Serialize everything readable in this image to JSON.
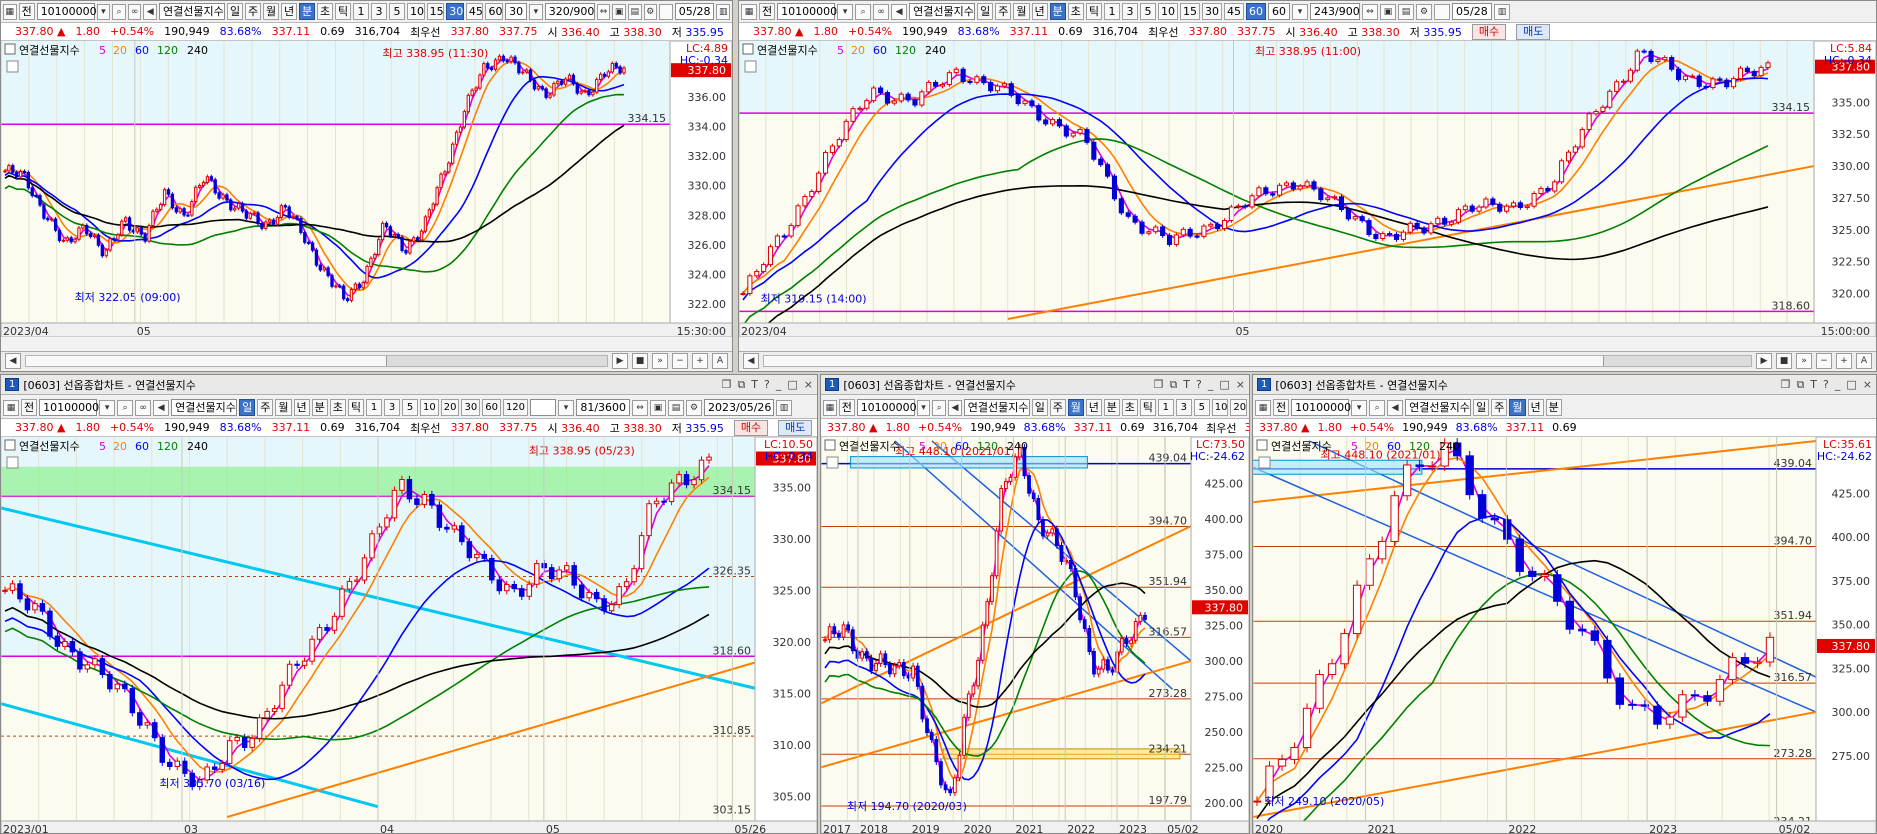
{
  "common": {
    "win_icon": "window-icon",
    "prev_btn": "전",
    "code": "10100000",
    "name": "연결선물지수",
    "periods": [
      "일",
      "주",
      "월",
      "년",
      "분",
      "초",
      "틱"
    ],
    "intervals_a": [
      "1",
      "3",
      "5",
      "10",
      "15",
      "30",
      "45",
      "60"
    ],
    "quote": {
      "price": "337.80",
      "arrow": "▲",
      "change": "1.80",
      "pct": "+0.54%",
      "volume": "190,949",
      "vol_ratio": "83.68%",
      "basis": "337.11",
      "basis_diff": "0.69",
      "oi": "316,704",
      "best_label": "최우선",
      "best_ask": "337.80",
      "best_bid": "337.75",
      "open_label": "시",
      "open": "336.40",
      "high_label": "고",
      "high": "338.30",
      "low_label": "저",
      "low": "335.95",
      "buy": "매수",
      "sell": "매도"
    },
    "legend": [
      "연결선물지수",
      "5",
      "20",
      "60",
      "120",
      "240"
    ],
    "legend_colors": [
      "#000000",
      "#e000e0",
      "#ff8000",
      "#0000ff",
      "#008000",
      "#000000"
    ]
  },
  "p1": {
    "interval_sel": "30",
    "interval_input": "30",
    "count": "320/900",
    "date": "05/28",
    "lc": "LC:4.89",
    "hc": "HC:-0.34",
    "price_tag": "337.80",
    "hline_label": "334.15",
    "high_note": "최고 338.95 (11:30)",
    "low_note": "최저 322.05 (09:00)",
    "yticks": [
      "336.00",
      "334.00",
      "332.00",
      "330.00",
      "328.00",
      "326.00",
      "324.00",
      "322.00"
    ],
    "xlabels": [
      "2023/04",
      "05"
    ],
    "time": "15:30:00"
  },
  "p2": {
    "interval_sel": "60",
    "interval_input": "60",
    "count": "243/900",
    "date": "05/28",
    "lc": "LC:5.84",
    "hc": "HC:-0.34",
    "price_tag": "337.80",
    "hline_label": "334.15",
    "bottom_label": "318.60",
    "high_note": "최고 338.95 (11:00)",
    "low_note": "최저 319.15 (14:00)",
    "yticks": [
      "335.00",
      "332.50",
      "330.00",
      "327.50",
      "325.00",
      "322.50",
      "320.00"
    ],
    "xlabels": [
      "2023/04",
      "05"
    ],
    "time": "15:00:00"
  },
  "p3": {
    "title_num": "1",
    "title": "[0603] 선옵종합차트 - 연결선물지수",
    "intervals": [
      "1",
      "3",
      "5",
      "10",
      "20",
      "30",
      "60",
      "120"
    ],
    "count": "81/3600",
    "date": "2023/05/26",
    "lc": "LC:10.50",
    "hc": "HC:-0.34",
    "price_tag": "337.80",
    "levels": [
      "334.15",
      "326.35",
      "318.60",
      "310.85",
      "303.15"
    ],
    "high_note": "최고 338.95 (05/23)",
    "low_note": "최저 305.70 (03/16)",
    "yticks": [
      "335.00",
      "330.00",
      "325.00",
      "320.00",
      "315.00",
      "310.00",
      "305.00"
    ],
    "xlabels": [
      "2023/01",
      "03",
      "04",
      "05",
      "05/26"
    ]
  },
  "p4": {
    "title_num": "1",
    "title": "[0603] 선옵종합차트 - 연결선물지수",
    "intervals": [
      "1",
      "3",
      "5",
      "10",
      "20"
    ],
    "lc": "LC:73.50",
    "hc": "HC:-24.62",
    "price_tag": "337.80",
    "levels": [
      "439.04",
      "394.70",
      "351.94",
      "316.57",
      "273.28",
      "234.21",
      "197.79"
    ],
    "high_note": "최고 448.10 (2021/01)",
    "low_note": "최저 194.70 (2020/03)",
    "yticks": [
      "425.00",
      "400.00",
      "375.00",
      "350.00",
      "325.00",
      "300.00",
      "275.00",
      "250.00",
      "225.00",
      "200.00"
    ],
    "xlabels": [
      "2017",
      "2018",
      "2019",
      "2020",
      "2021",
      "2022",
      "2023",
      "05/02"
    ]
  },
  "p5": {
    "title_num": "1",
    "title": "[0603] 선옵종합차트 - 연결선물지수",
    "lc": "LC:35.61",
    "hc": "HC:-24.62",
    "price_tag": "337.80",
    "levels": [
      "439.04",
      "394.70",
      "351.94",
      "316.57",
      "273.28",
      "234.21"
    ],
    "high_note": "최고 448.10 (2021/01)",
    "low_note": "최저 249.10 (2020/05)",
    "yticks": [
      "425.00",
      "400.00",
      "375.00",
      "350.00",
      "325.00",
      "300.00",
      "275.00"
    ],
    "xlabels": [
      "2020",
      "2021",
      "2022",
      "2023",
      "05/02"
    ]
  },
  "chart_data": [
    {
      "type": "line",
      "title": "연결선물지수 30분",
      "ylim": [
        321,
        339.5
      ],
      "hline": 334.15,
      "last": 337.8,
      "series": [
        {
          "name": "연결선물지수",
          "values": [
            331,
            330.5,
            328.2,
            325.8,
            327.5,
            325.2,
            327.8,
            326.5,
            329.5,
            328,
            330.5,
            329.2,
            328,
            327.4,
            328.5,
            326.5,
            324.2,
            322.2,
            324,
            327.2,
            325.8,
            327.2,
            331,
            335.2,
            337.8,
            338.95,
            337.4,
            336.3,
            337.2,
            336.1,
            337.7,
            337.8
          ]
        }
      ]
    },
    {
      "type": "line",
      "title": "연결선물지수 60분",
      "ylim": [
        318,
        339.5
      ],
      "hline": 334.15,
      "last": 337.8,
      "series": [
        {
          "name": "연결선물지수",
          "values": [
            320,
            325,
            331,
            336,
            335,
            337.5,
            336,
            334,
            332,
            326,
            324,
            325.5,
            327.5,
            329,
            326.5,
            324.5,
            325,
            327,
            326.5,
            329,
            334.5,
            338.95,
            337,
            336.5,
            337.8
          ]
        }
      ]
    },
    {
      "type": "line",
      "title": "연결선물지수 일",
      "ylim": [
        303,
        339.5
      ],
      "last": 337.8,
      "series": [
        {
          "name": "연결선물지수",
          "values": [
            325,
            323,
            320,
            318,
            315,
            312,
            308,
            305.7,
            310,
            312,
            316,
            320,
            325,
            329,
            335,
            334,
            330,
            327,
            325,
            327,
            326,
            324,
            325,
            333,
            336,
            337.8
          ]
        }
      ]
    },
    {
      "type": "line",
      "title": "연결선물지수 주",
      "ylim": [
        190,
        455
      ],
      "last": 337.8,
      "series": [
        {
          "name": "연결선물지수",
          "values": [
            315,
            320,
            305,
            300,
            290,
            294,
            240,
            194.7,
            270,
            330,
            420,
            448.1,
            400,
            380,
            355,
            300,
            290,
            316,
            337.8
          ]
        }
      ]
    },
    {
      "type": "line",
      "title": "연결선물지수 월",
      "ylim": [
        240,
        455
      ],
      "last": 337.8,
      "series": [
        {
          "name": "연결선물지수",
          "values": [
            249.1,
            290,
            360,
            430,
            448.1,
            410,
            380,
            340,
            300,
            305,
            316,
            337.8
          ]
        }
      ]
    }
  ]
}
